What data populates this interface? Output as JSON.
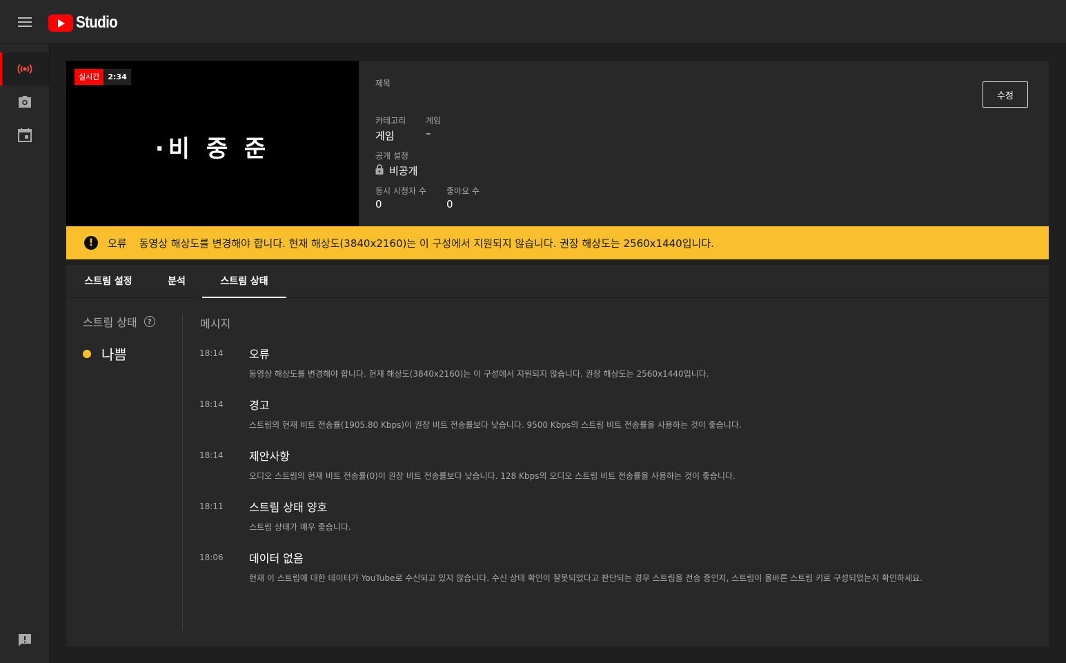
{
  "header": {
    "logo_text": "Studio"
  },
  "preview": {
    "live_label": "실시간",
    "live_time": "2:34",
    "overlay_text": "·비 중 준"
  },
  "details": {
    "title_label": "제목",
    "category_label": "카테고리",
    "category_value": "게임",
    "game_label": "게임",
    "game_value": "–",
    "privacy_label": "공개 설정",
    "privacy_value": "비공개",
    "viewers_label": "동시 시청자 수",
    "viewers_value": "0",
    "likes_label": "좋아요 수",
    "likes_value": "0",
    "edit_button": "수정"
  },
  "banner": {
    "label": "오류",
    "message": "동영상 해상도를 변경해야 합니다. 현재 해상도(3840x2160)는 이 구성에서 지원되지 않습니다. 권장 해상도는 2560x1440입니다.",
    "color": "#f9bf2c"
  },
  "tabs": [
    {
      "label": "스트림 설정"
    },
    {
      "label": "분석"
    },
    {
      "label": "스트림 상태"
    }
  ],
  "status": {
    "title": "스트림 상태",
    "value": "나쁨",
    "messages_header": "메시지"
  },
  "messages": [
    {
      "time": "18:14",
      "title": "오류",
      "desc": "동영상 해상도를 변경해야 합니다. 현재 해상도(3840x2160)는 이 구성에서 지원되지 않습니다. 권장 해상도는 2560x1440입니다."
    },
    {
      "time": "18:14",
      "title": "경고",
      "desc": "스트림의 현재 비트 전송률(1905.80 Kbps)이 권장 비트 전송률보다 낮습니다. 9500 Kbps의 스트림 비트 전송률을 사용하는 것이 좋습니다."
    },
    {
      "time": "18:14",
      "title": "제안사항",
      "desc": "오디오 스트림의 현재 비트 전송률(0)이 권장 비트 전송률보다 낮습니다. 128 Kbps의 오디오 스트림 비트 전송률을 사용하는 것이 좋습니다."
    },
    {
      "time": "18:11",
      "title": "스트림 상태 양호",
      "desc": "스트림 상태가 매우 좋습니다."
    },
    {
      "time": "18:06",
      "title": "데이터 없음",
      "desc": "현재 이 스트림에 대한 데이터가 YouTube로 수신되고 있지 않습니다. 수신 상태 확인이 잘못되었다고 판단되는 경우 스트림을 전송 중인지, 스트림이 올바른 스트림 키로 구성되었는지 확인하세요."
    }
  ]
}
